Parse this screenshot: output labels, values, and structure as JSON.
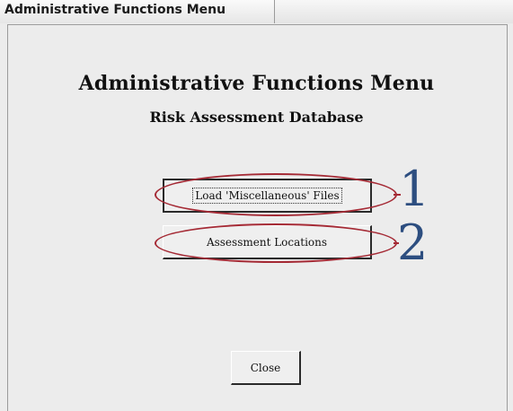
{
  "window": {
    "title": "Administrative Functions Menu"
  },
  "header": {
    "title": "Administrative Functions Menu",
    "subtitle": "Risk Assessment Database"
  },
  "buttons": {
    "load_files": "Load 'Miscellaneous' Files",
    "assessment_locations": "Assessment Locations",
    "close": "Close"
  },
  "annotations": {
    "callout_1": "1",
    "callout_2": "2",
    "highlight_color": "#a52a35",
    "number_color": "#2d4e80"
  }
}
